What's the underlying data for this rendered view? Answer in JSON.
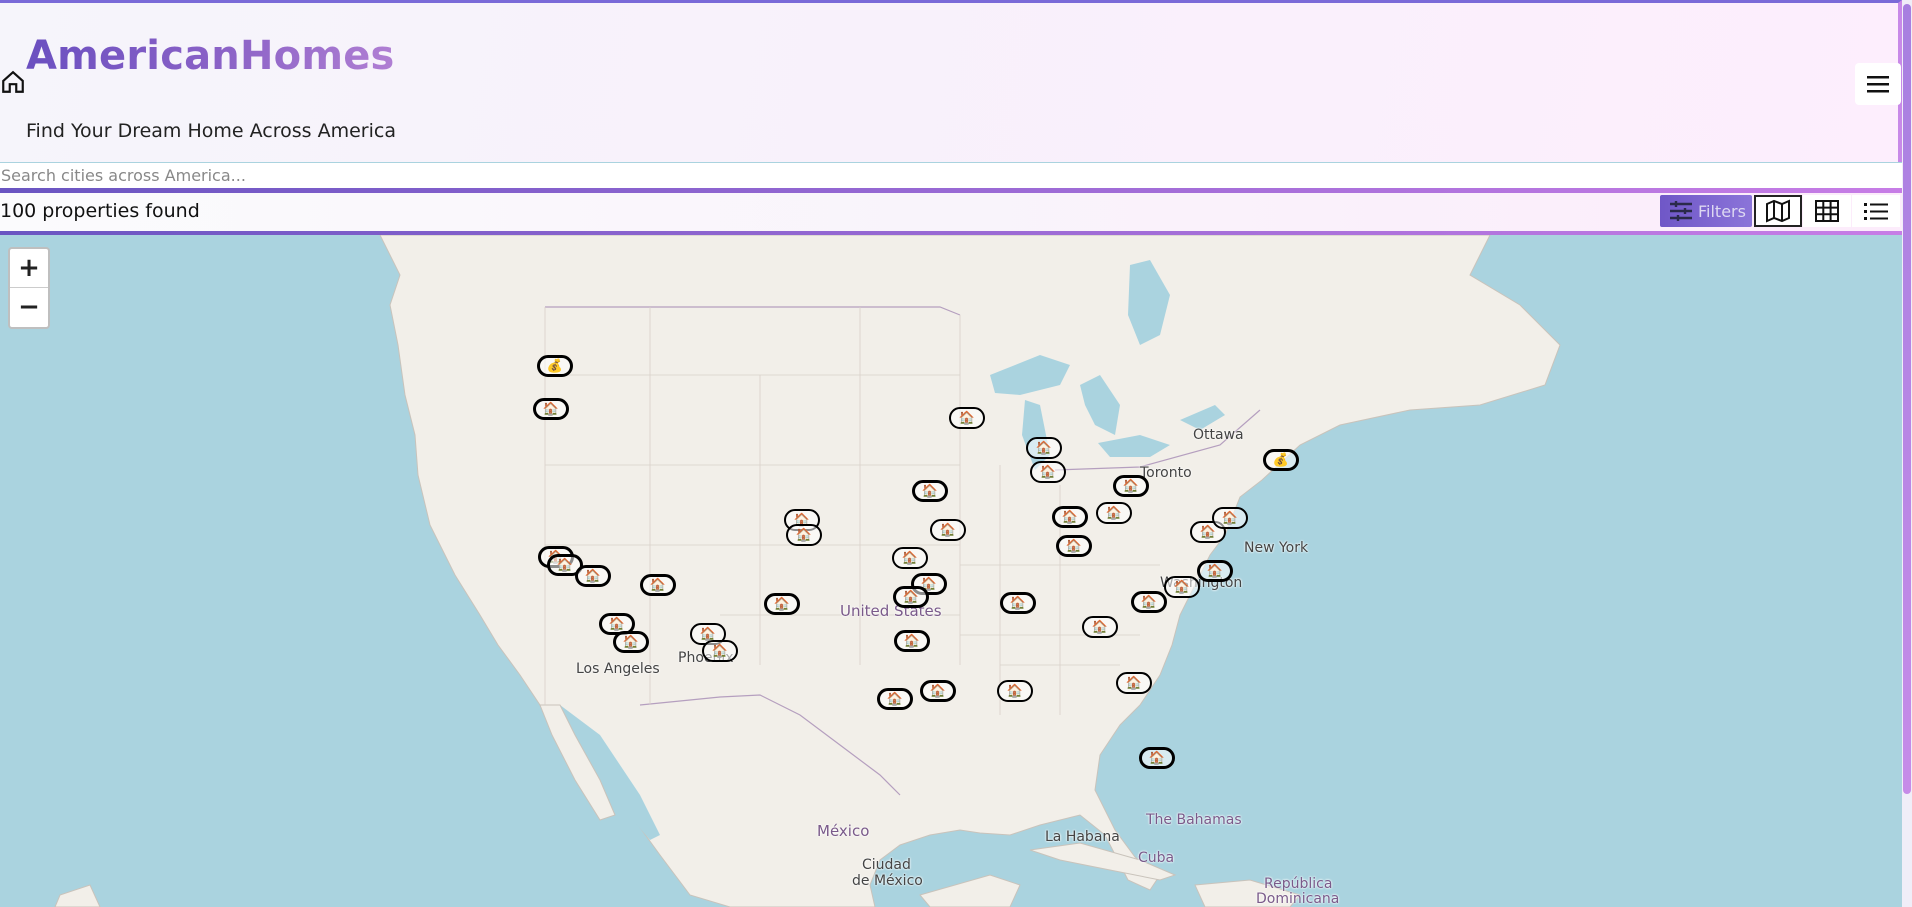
{
  "header": {
    "brand_prefix": "American",
    "brand_suffix": "Homes",
    "tagline": "Find Your Dream Home Across America",
    "search_placeholder": "Search cities across America...",
    "menu_icon": "hamburger-icon",
    "home_icon": "home-icon"
  },
  "results": {
    "count_text": "100 properties found",
    "filters_label": "Filters",
    "views": [
      {
        "name": "map-view",
        "icon": "map-icon",
        "active": true
      },
      {
        "name": "grid-view",
        "icon": "grid-icon",
        "active": false
      },
      {
        "name": "list-view",
        "icon": "list-icon",
        "active": false
      }
    ]
  },
  "map": {
    "zoom_in": "+",
    "zoom_out": "−",
    "labels": {
      "ottawa": "Ottawa",
      "toronto": "Toronto",
      "new_york": "New York",
      "washington": "Washington",
      "united_states": "United States",
      "los_angeles": "Los Angeles",
      "phoenix": "Phoenix",
      "mexico": "México",
      "ciudad": "Ciudad",
      "de_mexico": "de México",
      "la_habana": "La Habana",
      "bahamas": "The Bahamas",
      "cuba": "Cuba",
      "republica": "República",
      "dominicana": "Dominicana"
    },
    "marker_icons": {
      "house": "🏠",
      "money_bag": "💰"
    }
  },
  "colors": {
    "accent_start": "#6a55c2",
    "accent_end": "#c77de6",
    "water": "#aad3df",
    "land": "#f2efe9"
  }
}
